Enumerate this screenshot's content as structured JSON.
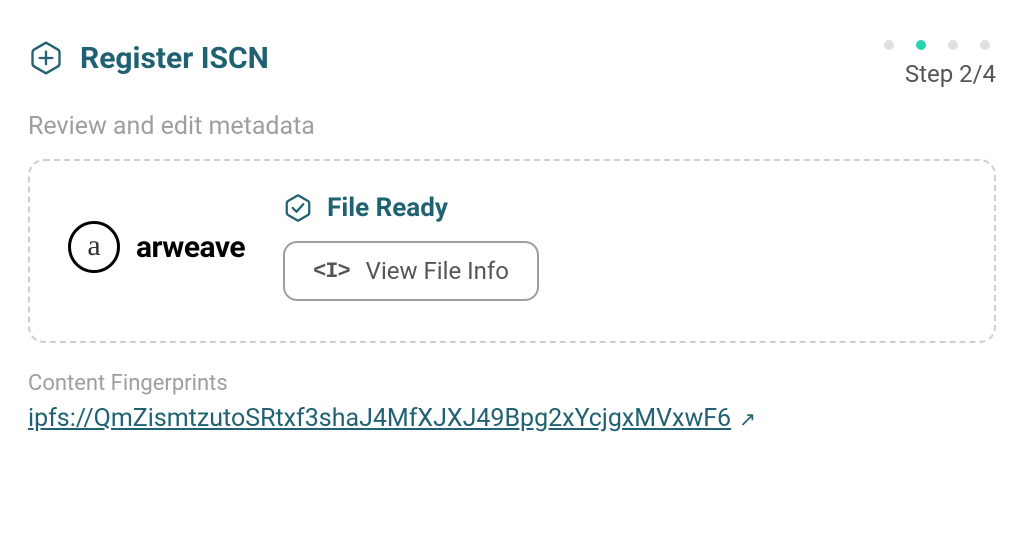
{
  "header": {
    "title": "Register ISCN"
  },
  "stepper": {
    "dots": 4,
    "active": 1,
    "label": "Step 2/4"
  },
  "subtitle": "Review and edit metadata",
  "file_box": {
    "logo_letter": "a",
    "logo_text": "arweave",
    "ready_label": "File Ready",
    "view_button": "View File Info"
  },
  "fingerprints": {
    "label": "Content Fingerprints",
    "link": "ipfs://QmZismtzutoSRtxf3shaJ4MfXJXJ49Bpg2xYcjgxMVxwF6"
  }
}
